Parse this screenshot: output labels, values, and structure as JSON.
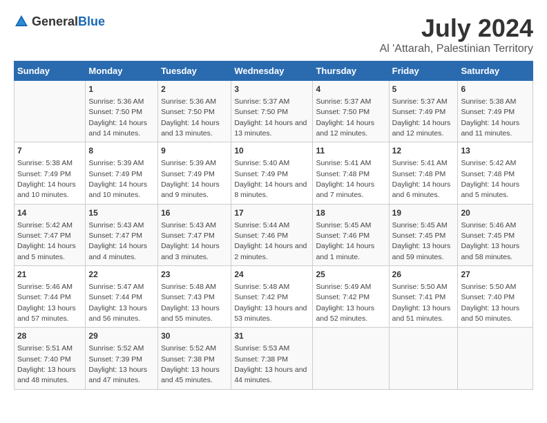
{
  "logo": {
    "general": "General",
    "blue": "Blue"
  },
  "title": "July 2024",
  "subtitle": "Al 'Attarah, Palestinian Territory",
  "days": [
    "Sunday",
    "Monday",
    "Tuesday",
    "Wednesday",
    "Thursday",
    "Friday",
    "Saturday"
  ],
  "weeks": [
    [
      {
        "date": "",
        "sunrise": "",
        "sunset": "",
        "daylight": ""
      },
      {
        "date": "1",
        "sunrise": "Sunrise: 5:36 AM",
        "sunset": "Sunset: 7:50 PM",
        "daylight": "Daylight: 14 hours and 14 minutes."
      },
      {
        "date": "2",
        "sunrise": "Sunrise: 5:36 AM",
        "sunset": "Sunset: 7:50 PM",
        "daylight": "Daylight: 14 hours and 13 minutes."
      },
      {
        "date": "3",
        "sunrise": "Sunrise: 5:37 AM",
        "sunset": "Sunset: 7:50 PM",
        "daylight": "Daylight: 14 hours and 13 minutes."
      },
      {
        "date": "4",
        "sunrise": "Sunrise: 5:37 AM",
        "sunset": "Sunset: 7:50 PM",
        "daylight": "Daylight: 14 hours and 12 minutes."
      },
      {
        "date": "5",
        "sunrise": "Sunrise: 5:37 AM",
        "sunset": "Sunset: 7:49 PM",
        "daylight": "Daylight: 14 hours and 12 minutes."
      },
      {
        "date": "6",
        "sunrise": "Sunrise: 5:38 AM",
        "sunset": "Sunset: 7:49 PM",
        "daylight": "Daylight: 14 hours and 11 minutes."
      }
    ],
    [
      {
        "date": "7",
        "sunrise": "Sunrise: 5:38 AM",
        "sunset": "Sunset: 7:49 PM",
        "daylight": "Daylight: 14 hours and 10 minutes."
      },
      {
        "date": "8",
        "sunrise": "Sunrise: 5:39 AM",
        "sunset": "Sunset: 7:49 PM",
        "daylight": "Daylight: 14 hours and 10 minutes."
      },
      {
        "date": "9",
        "sunrise": "Sunrise: 5:39 AM",
        "sunset": "Sunset: 7:49 PM",
        "daylight": "Daylight: 14 hours and 9 minutes."
      },
      {
        "date": "10",
        "sunrise": "Sunrise: 5:40 AM",
        "sunset": "Sunset: 7:49 PM",
        "daylight": "Daylight: 14 hours and 8 minutes."
      },
      {
        "date": "11",
        "sunrise": "Sunrise: 5:41 AM",
        "sunset": "Sunset: 7:48 PM",
        "daylight": "Daylight: 14 hours and 7 minutes."
      },
      {
        "date": "12",
        "sunrise": "Sunrise: 5:41 AM",
        "sunset": "Sunset: 7:48 PM",
        "daylight": "Daylight: 14 hours and 6 minutes."
      },
      {
        "date": "13",
        "sunrise": "Sunrise: 5:42 AM",
        "sunset": "Sunset: 7:48 PM",
        "daylight": "Daylight: 14 hours and 5 minutes."
      }
    ],
    [
      {
        "date": "14",
        "sunrise": "Sunrise: 5:42 AM",
        "sunset": "Sunset: 7:47 PM",
        "daylight": "Daylight: 14 hours and 5 minutes."
      },
      {
        "date": "15",
        "sunrise": "Sunrise: 5:43 AM",
        "sunset": "Sunset: 7:47 PM",
        "daylight": "Daylight: 14 hours and 4 minutes."
      },
      {
        "date": "16",
        "sunrise": "Sunrise: 5:43 AM",
        "sunset": "Sunset: 7:47 PM",
        "daylight": "Daylight: 14 hours and 3 minutes."
      },
      {
        "date": "17",
        "sunrise": "Sunrise: 5:44 AM",
        "sunset": "Sunset: 7:46 PM",
        "daylight": "Daylight: 14 hours and 2 minutes."
      },
      {
        "date": "18",
        "sunrise": "Sunrise: 5:45 AM",
        "sunset": "Sunset: 7:46 PM",
        "daylight": "Daylight: 14 hours and 1 minute."
      },
      {
        "date": "19",
        "sunrise": "Sunrise: 5:45 AM",
        "sunset": "Sunset: 7:45 PM",
        "daylight": "Daylight: 13 hours and 59 minutes."
      },
      {
        "date": "20",
        "sunrise": "Sunrise: 5:46 AM",
        "sunset": "Sunset: 7:45 PM",
        "daylight": "Daylight: 13 hours and 58 minutes."
      }
    ],
    [
      {
        "date": "21",
        "sunrise": "Sunrise: 5:46 AM",
        "sunset": "Sunset: 7:44 PM",
        "daylight": "Daylight: 13 hours and 57 minutes."
      },
      {
        "date": "22",
        "sunrise": "Sunrise: 5:47 AM",
        "sunset": "Sunset: 7:44 PM",
        "daylight": "Daylight: 13 hours and 56 minutes."
      },
      {
        "date": "23",
        "sunrise": "Sunrise: 5:48 AM",
        "sunset": "Sunset: 7:43 PM",
        "daylight": "Daylight: 13 hours and 55 minutes."
      },
      {
        "date": "24",
        "sunrise": "Sunrise: 5:48 AM",
        "sunset": "Sunset: 7:42 PM",
        "daylight": "Daylight: 13 hours and 53 minutes."
      },
      {
        "date": "25",
        "sunrise": "Sunrise: 5:49 AM",
        "sunset": "Sunset: 7:42 PM",
        "daylight": "Daylight: 13 hours and 52 minutes."
      },
      {
        "date": "26",
        "sunrise": "Sunrise: 5:50 AM",
        "sunset": "Sunset: 7:41 PM",
        "daylight": "Daylight: 13 hours and 51 minutes."
      },
      {
        "date": "27",
        "sunrise": "Sunrise: 5:50 AM",
        "sunset": "Sunset: 7:40 PM",
        "daylight": "Daylight: 13 hours and 50 minutes."
      }
    ],
    [
      {
        "date": "28",
        "sunrise": "Sunrise: 5:51 AM",
        "sunset": "Sunset: 7:40 PM",
        "daylight": "Daylight: 13 hours and 48 minutes."
      },
      {
        "date": "29",
        "sunrise": "Sunrise: 5:52 AM",
        "sunset": "Sunset: 7:39 PM",
        "daylight": "Daylight: 13 hours and 47 minutes."
      },
      {
        "date": "30",
        "sunrise": "Sunrise: 5:52 AM",
        "sunset": "Sunset: 7:38 PM",
        "daylight": "Daylight: 13 hours and 45 minutes."
      },
      {
        "date": "31",
        "sunrise": "Sunrise: 5:53 AM",
        "sunset": "Sunset: 7:38 PM",
        "daylight": "Daylight: 13 hours and 44 minutes."
      },
      {
        "date": "",
        "sunrise": "",
        "sunset": "",
        "daylight": ""
      },
      {
        "date": "",
        "sunrise": "",
        "sunset": "",
        "daylight": ""
      },
      {
        "date": "",
        "sunrise": "",
        "sunset": "",
        "daylight": ""
      }
    ]
  ]
}
